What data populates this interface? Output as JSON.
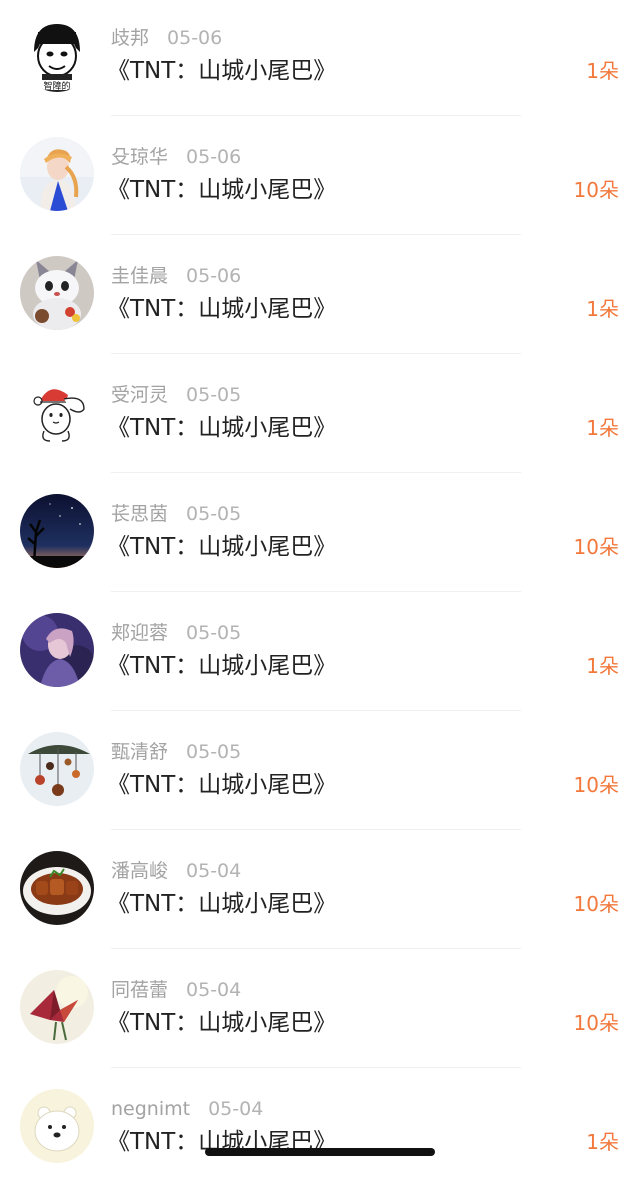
{
  "gift_list": [
    {
      "name": "歧邦",
      "date": "05-06",
      "title": "《TNT：山城小尾巴》",
      "gift": "1朵",
      "avatar_icon": "meme-face-avatar-icon"
    },
    {
      "name": "殳琼华",
      "date": "05-06",
      "title": "《TNT：山城小尾巴》",
      "gift": "10朵",
      "avatar_icon": "girl-photo-avatar-icon"
    },
    {
      "name": "圭佳晨",
      "date": "05-06",
      "title": "《TNT：山城小尾巴》",
      "gift": "1朵",
      "avatar_icon": "plush-cat-avatar-icon"
    },
    {
      "name": "受河灵",
      "date": "05-05",
      "title": "《TNT：山城小尾巴》",
      "gift": "1朵",
      "avatar_icon": "christmas-bunny-avatar-icon"
    },
    {
      "name": "苌思茵",
      "date": "05-05",
      "title": "《TNT：山城小尾巴》",
      "gift": "10朵",
      "avatar_icon": "night-sky-avatar-icon"
    },
    {
      "name": "郏迎蓉",
      "date": "05-05",
      "title": "《TNT：山城小尾巴》",
      "gift": "1朵",
      "avatar_icon": "purple-portrait-avatar-icon"
    },
    {
      "name": "甄清舒",
      "date": "05-05",
      "title": "《TNT：山城小尾巴》",
      "gift": "10朵",
      "avatar_icon": "wind-chimes-avatar-icon"
    },
    {
      "name": "潘高峻",
      "date": "05-04",
      "title": "《TNT：山城小尾巴》",
      "gift": "10朵",
      "avatar_icon": "braised-pork-avatar-icon"
    },
    {
      "name": "同蓓蕾",
      "date": "05-04",
      "title": "《TNT：山城小尾巴》",
      "gift": "10朵",
      "avatar_icon": "paper-crane-avatar-icon"
    },
    {
      "name": "negnimt",
      "date": "05-04",
      "title": "《TNT：山城小尾巴》",
      "gift": "1朵",
      "avatar_icon": "polar-bear-avatar-icon"
    }
  ],
  "colors": {
    "gift_accent": "#f2783c",
    "meta_gray": "#a3a3a3",
    "title_text": "#222222"
  }
}
